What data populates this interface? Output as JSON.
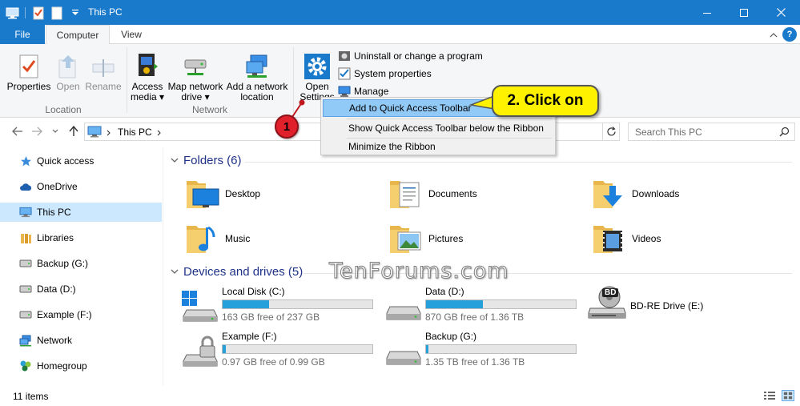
{
  "window": {
    "title": "This PC",
    "colors": {
      "accent": "#1979ca",
      "selection": "#cce8ff",
      "drive_bar": "#26a0da",
      "callout": "#fff200",
      "badge": "#e0202a",
      "section_header": "#1e3287"
    }
  },
  "ribbon_tabs": {
    "file": "File",
    "computer": "Computer",
    "view": "View",
    "help": "?"
  },
  "ribbon": {
    "location_group": {
      "label": "Location",
      "properties": "Properties",
      "open": "Open",
      "rename": "Rename"
    },
    "network_group": {
      "label": "Network",
      "access_media_1": "Access",
      "access_media_2": "media ▾",
      "map_drive_1": "Map network",
      "map_drive_2": "drive ▾",
      "add_location_1": "Add a network",
      "add_location_2": "location"
    },
    "system_group": {
      "open_settings_1": "Open",
      "open_settings_2": "Settings",
      "uninstall": "Uninstall or change a program",
      "system_properties": "System properties",
      "manage": "Manage"
    }
  },
  "context_menu": {
    "items": [
      "Add to Quick Access Toolbar",
      "Show Quick Access Toolbar below the Ribbon",
      "Minimize the Ribbon"
    ]
  },
  "address_bar": {
    "crumb": "This PC",
    "search_placeholder": "Search This PC"
  },
  "nav_pane": {
    "items": [
      {
        "label": "Quick access",
        "icon": "star-icon"
      },
      {
        "label": "OneDrive",
        "icon": "cloud-icon"
      },
      {
        "label": "This PC",
        "icon": "computer-icon"
      },
      {
        "label": "Libraries",
        "icon": "library-icon"
      },
      {
        "label": "Backup (G:)",
        "icon": "drive-icon"
      },
      {
        "label": "Data (D:)",
        "icon": "drive-icon"
      },
      {
        "label": "Example (F:)",
        "icon": "drive-icon"
      },
      {
        "label": "Network",
        "icon": "network-icon"
      },
      {
        "label": "Homegroup",
        "icon": "homegroup-icon"
      }
    ]
  },
  "content": {
    "folders_header": "Folders (6)",
    "folders": [
      {
        "name": "Desktop",
        "icon": "desktop-folder-icon"
      },
      {
        "name": "Documents",
        "icon": "documents-folder-icon"
      },
      {
        "name": "Downloads",
        "icon": "downloads-folder-icon"
      },
      {
        "name": "Music",
        "icon": "music-folder-icon"
      },
      {
        "name": "Pictures",
        "icon": "pictures-folder-icon"
      },
      {
        "name": "Videos",
        "icon": "videos-folder-icon"
      }
    ],
    "drives_header": "Devices and drives (5)",
    "drives": [
      {
        "name": "Local Disk (C:)",
        "free": "163 GB free of 237 GB",
        "used_fraction": 0.31
      },
      {
        "name": "Data (D:)",
        "free": "870 GB free of 1.36 TB",
        "used_fraction": 0.38
      },
      {
        "name": "BD-RE Drive (E:)",
        "free": "",
        "used_fraction": null
      },
      {
        "name": "Example (F:)",
        "free": "0.97 GB free of 0.99 GB",
        "used_fraction": 0.02
      },
      {
        "name": "Backup (G:)",
        "free": "1.35 TB free of 1.36 TB",
        "used_fraction": 0.01
      }
    ]
  },
  "status_bar": {
    "items": "11 items"
  },
  "annotations": {
    "callout": "2. Click on",
    "badge": "1",
    "watermark": "TenForums.com",
    "bd_label": "BD"
  }
}
